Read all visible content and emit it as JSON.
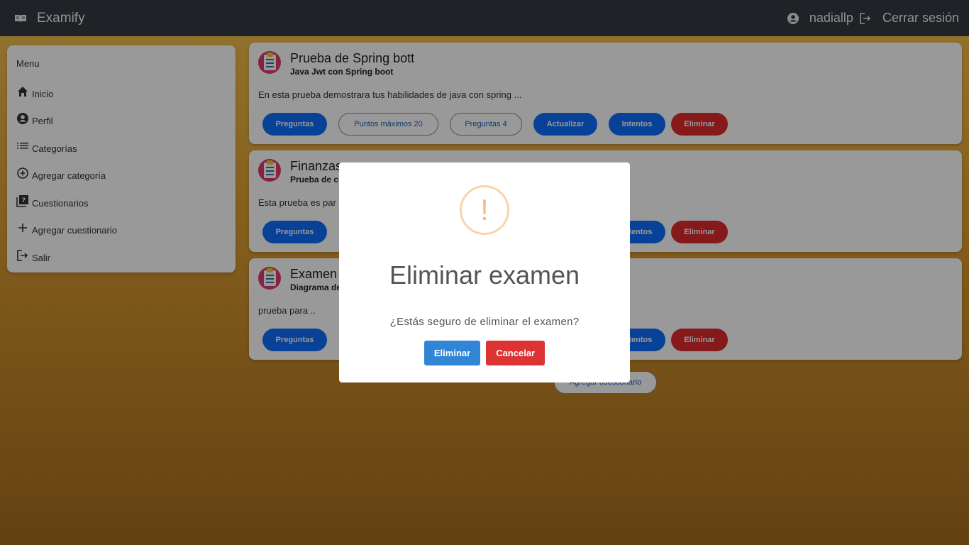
{
  "app": {
    "brand": "Examify"
  },
  "toolbar": {
    "username": "nadiallp",
    "logout": "Cerrar sesión"
  },
  "sidebar": {
    "title": "Menu",
    "items": [
      {
        "label": "Inicio",
        "icon": "home-icon"
      },
      {
        "label": "Perfil",
        "icon": "account-icon"
      },
      {
        "label": "Categorías",
        "icon": "list-icon"
      },
      {
        "label": "Agregar categoría",
        "icon": "add-circle-icon"
      },
      {
        "label": "Cuestionarios",
        "icon": "quiz-icon"
      },
      {
        "label": "Agregar cuestionario",
        "icon": "plus-icon"
      },
      {
        "label": "Salir",
        "icon": "logout-icon"
      }
    ]
  },
  "exams": [
    {
      "title": "Prueba de Spring bott",
      "subtitle": "Java Jwt con Spring boot",
      "description": "En esta prueba demostrara tus habilidades de java con spring ...",
      "buttons": {
        "questions": "Preguntas",
        "max_points": "Puntos máximos 20",
        "question_count": "Preguntas 4",
        "update": "Actualizar",
        "attempts": "Intentos",
        "delete": "Eliminar"
      }
    },
    {
      "title": "Finanzas",
      "subtitle": "Prueba de c",
      "description": "Esta prueba es par",
      "buttons": {
        "questions": "Preguntas",
        "attempts": "Intentos",
        "delete": "Eliminar"
      }
    },
    {
      "title": "Examen c",
      "subtitle": "Diagrama de",
      "description": "prueba para ..",
      "buttons": {
        "questions": "Preguntas",
        "attempts": "Intentos",
        "delete": "Eliminar"
      }
    }
  ],
  "add_quiz_button": "Agregar cuestionario",
  "dialog": {
    "icon_glyph": "!",
    "title": "Eliminar examen",
    "text": "¿Estás seguro de eliminar el examen?",
    "confirm": "Eliminar",
    "cancel": "Cancelar"
  },
  "colors": {
    "toolbar": "#343a40",
    "primary": "#0d6efd",
    "warn": "#e02a2a",
    "dialog_confirm": "#3085d6",
    "dialog_cancel": "#dd3333",
    "warning_icon": "#f8bb86"
  }
}
